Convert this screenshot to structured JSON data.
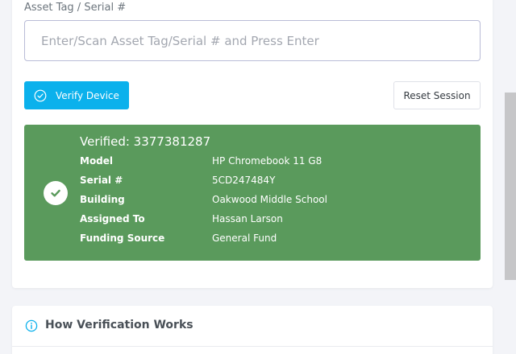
{
  "form": {
    "field_label": "Asset Tag / Serial #",
    "input_placeholder": "Enter/Scan Asset Tag/Serial # and Press Enter",
    "input_value": ""
  },
  "buttons": {
    "verify_label": "Verify Device",
    "reset_label": "Reset Session"
  },
  "result": {
    "title": "Verified: 3377381287",
    "fields": [
      {
        "label": "Model",
        "value": "HP Chromebook 11 G8"
      },
      {
        "label": "Serial #",
        "value": "5CD247484Y"
      },
      {
        "label": "Building",
        "value": "Oakwood Middle School"
      },
      {
        "label": "Assigned To",
        "value": "Hassan Larson"
      },
      {
        "label": "Funding Source",
        "value": "General Fund"
      }
    ]
  },
  "info": {
    "title": "How Verification Works"
  },
  "colors": {
    "primary": "#0bb1ec",
    "success": "#5a9a5c",
    "page_bg": "#f3f4f8"
  },
  "icons": {
    "verify": "check-circle-outline-icon",
    "result": "check-circle-icon",
    "info": "info-circle-icon"
  }
}
